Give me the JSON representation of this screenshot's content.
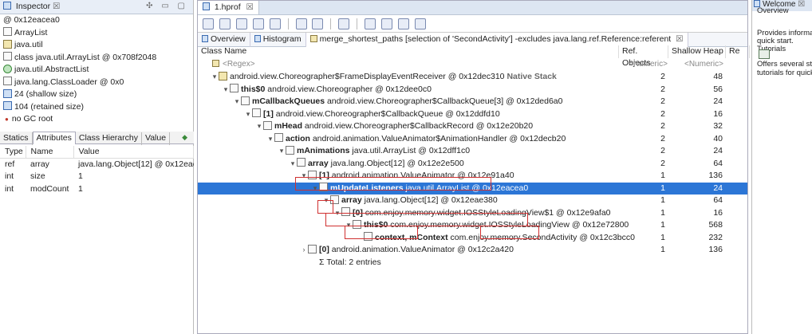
{
  "inspector": {
    "tab_label": "Inspector",
    "tab_close": "☒",
    "items": [
      "@ 0x12eacea0",
      "ArrayList",
      "java.util",
      "class java.util.ArrayList @ 0x708f2048",
      "java.util.AbstractList",
      "java.lang.ClassLoader @ 0x0",
      "24 (shallow size)",
      "104 (retained size)",
      "no GC root"
    ],
    "subtabs": [
      "Statics",
      "Attributes",
      "Class Hierarchy",
      "Value"
    ],
    "attr_headers": [
      "Type",
      "Name",
      "Value"
    ],
    "attr_rows": [
      [
        "ref",
        "array",
        "java.lang.Object[12] @ 0x12eae3"
      ],
      [
        "int",
        "size",
        "1"
      ],
      [
        "int",
        "modCount",
        "1"
      ]
    ]
  },
  "main": {
    "tab_label": "1.hprof",
    "tab_close": "☒",
    "subtabs": [
      "Overview",
      "Histogram",
      "merge_shortest_paths [selection of 'SecondActivity'] -excludes java.lang.ref.Reference:referent"
    ],
    "subtab_close": "☒",
    "columns": [
      "Class Name",
      "Ref. Objects",
      "Shallow Heap",
      "Re"
    ],
    "regex": [
      "<Regex>",
      "<Numeric>",
      "<Numeric>"
    ],
    "rows": [
      {
        "pre": "android.view.Choreographer$FrameDisplayEventReceiver @ 0x12dec310 ",
        "field": "",
        "post": "",
        "suffix": "Native Stack",
        "refs": "2",
        "shallow": "48"
      },
      {
        "field": "this$0",
        "pre": " android.view.Choreographer @ 0x12dee0c0",
        "post": "",
        "suffix": "",
        "refs": "2",
        "shallow": "56"
      },
      {
        "field": "mCallbackQueues",
        "pre": " android.view.Choreographer$CallbackQueue[3] @ 0x12ded6a0",
        "post": "",
        "suffix": "",
        "refs": "2",
        "shallow": "24"
      },
      {
        "field": "[1]",
        "pre": " android.view.Choreographer$CallbackQueue @ 0x12ddfd10",
        "post": "",
        "suffix": "",
        "refs": "2",
        "shallow": "16"
      },
      {
        "field": "mHead",
        "pre": " android.view.Choreographer$CallbackRecord @ 0x12e20b20",
        "post": "",
        "suffix": "",
        "refs": "2",
        "shallow": "32"
      },
      {
        "field": "action",
        "pre": " android.animation.ValueAnimator$AnimationHandler @ 0x12decb20",
        "post": "",
        "suffix": "",
        "refs": "2",
        "shallow": "40"
      },
      {
        "field": "mAnimations",
        "pre": " java.util.ArrayList @ 0x12dff1c0",
        "post": "",
        "suffix": "",
        "refs": "2",
        "shallow": "24"
      },
      {
        "field": "array",
        "pre": " java.lang.Object[12] @ 0x12e2e500",
        "post": "",
        "suffix": "",
        "refs": "2",
        "shallow": "64"
      },
      {
        "field": "[1]",
        "pre": " android.animation.ValueAnimator @ 0x12e91a40",
        "post": "",
        "suffix": "",
        "refs": "1",
        "shallow": "136"
      },
      {
        "field": "mUpdateListeners",
        "pre": " java.util.ArrayList @ 0x12eacea0",
        "post": "",
        "suffix": "",
        "refs": "1",
        "shallow": "24"
      },
      {
        "field": "array",
        "pre": " java.lang.Object[12] @ 0x12eae380",
        "post": "",
        "suffix": "",
        "refs": "1",
        "shallow": "64"
      },
      {
        "field": "[0]",
        "pre": " com.enjoy.memory.widget.IOSStyleLoadingView$1 @ 0x12e9afa0",
        "post": "",
        "suffix": "",
        "refs": "1",
        "shallow": "16"
      },
      {
        "field": "this$0",
        "pre": " com.enjoy.memory.widget.IOSStyleLoadingView @ 0x12e72800",
        "post": "",
        "suffix": "",
        "refs": "1",
        "shallow": "568"
      },
      {
        "field": "context, mContext",
        "pre": " com.enjoy.memory.SecondActivity @ 0x12c3bcc0",
        "post": "",
        "suffix": "",
        "refs": "1",
        "shallow": "232"
      },
      {
        "field": "[0]",
        "pre": " android.animation.ValueAnimator @ 0x12c2a420",
        "post": "",
        "suffix": "",
        "refs": "1",
        "shallow": "136"
      },
      {
        "field": "",
        "pre": "Total: 2 entries",
        "post": "",
        "suffix": "",
        "refs": "",
        "shallow": ""
      }
    ]
  },
  "welcome": {
    "tab_label": "Welcome",
    "tab_close": "☒",
    "lines": [
      "Overview",
      "Provides informat",
      "quick start.",
      "Tutorials",
      "Offers several ste",
      "tutorials for quick"
    ]
  },
  "colors": {
    "selection": "#2c76d6",
    "highlight_box": "#d03030",
    "tab_bg": "#dde6f2"
  }
}
